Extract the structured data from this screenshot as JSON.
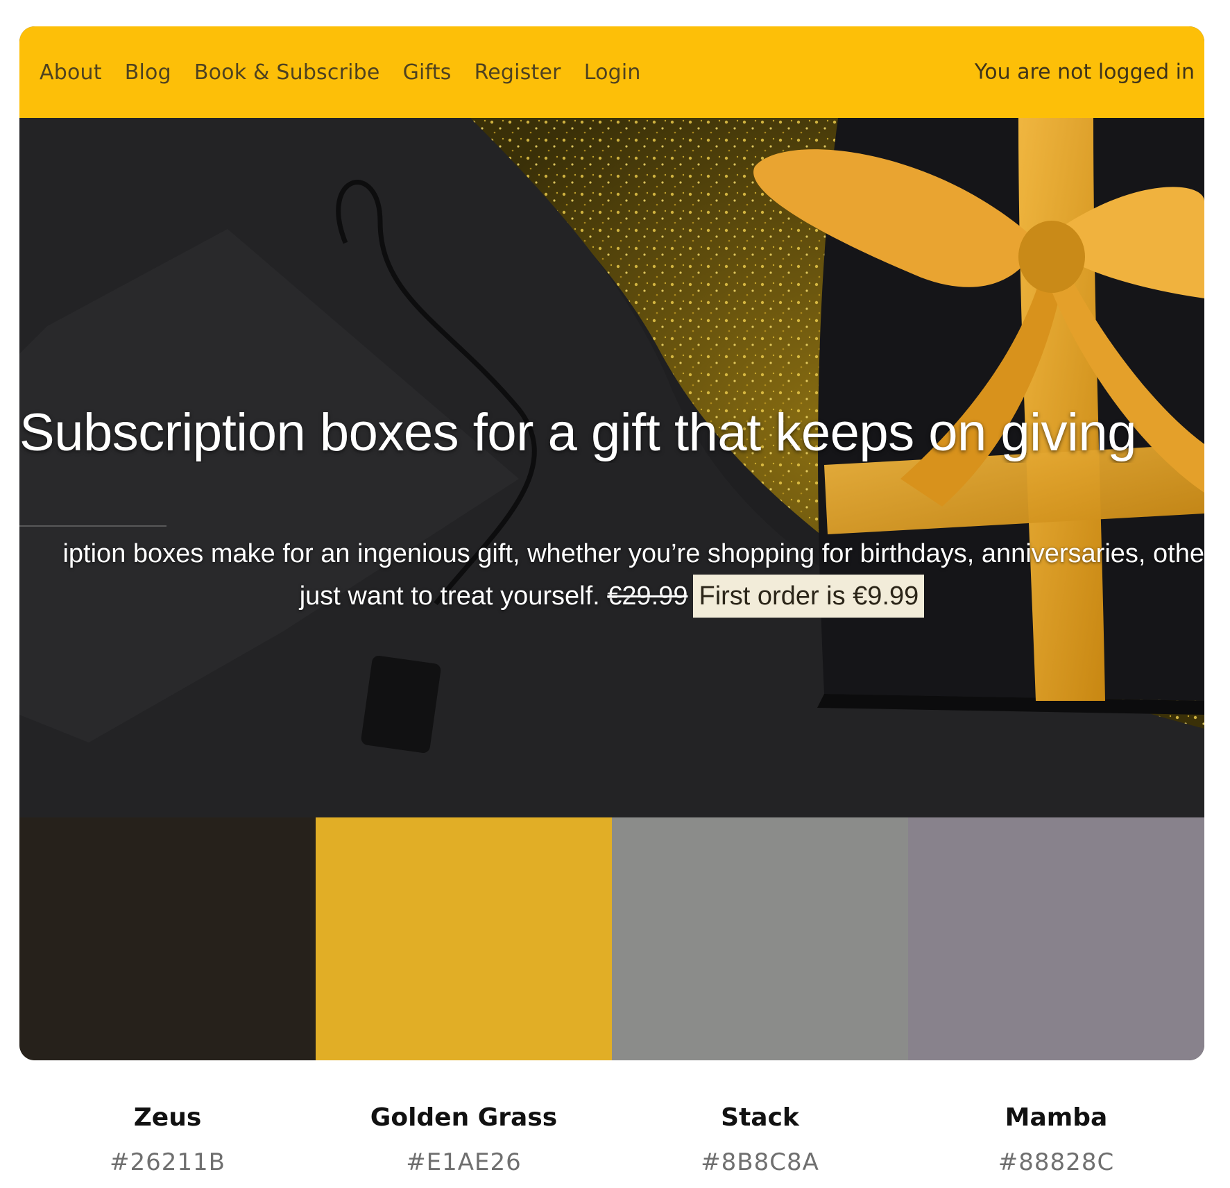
{
  "nav": {
    "items": [
      {
        "label": "About"
      },
      {
        "label": "Blog"
      },
      {
        "label": "Book & Subscribe"
      },
      {
        "label": "Gifts"
      },
      {
        "label": "Register"
      },
      {
        "label": "Login"
      }
    ],
    "status": "You are not logged in"
  },
  "hero": {
    "title": "Subscription boxes for a gift that keeps on giving",
    "text_line1": "iption boxes make for an ingenious gift, whether you’re shopping for birthdays, anniversaries, othe",
    "text_line2_prefix": "just want to treat yourself. ",
    "old_price": "€29.99",
    "promo": "First order is €9.99"
  },
  "palette": [
    {
      "name": "Zeus",
      "hex": "#26211B"
    },
    {
      "name": "Golden Grass",
      "hex": "#E1AE26"
    },
    {
      "name": "Stack",
      "hex": "#8B8C8A"
    },
    {
      "name": "Mamba",
      "hex": "#88828C"
    }
  ],
  "colors": {
    "nav_bg": "#FDBF08"
  }
}
